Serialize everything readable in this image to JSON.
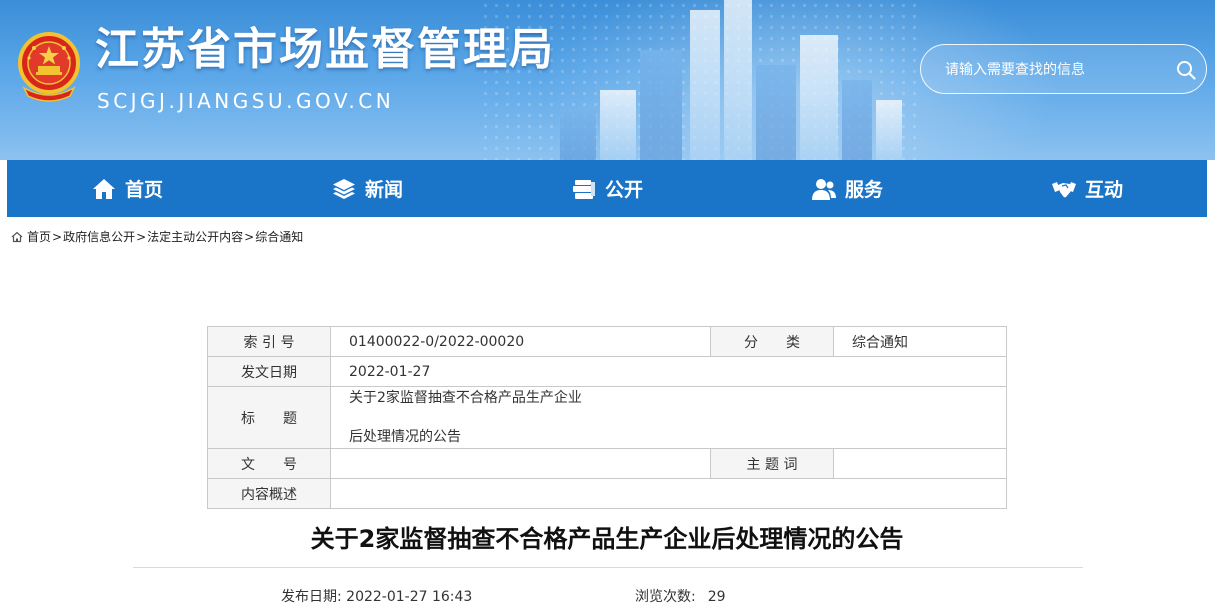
{
  "header": {
    "site_title": "江苏省市场监督管理局",
    "site_url": "SCJGJ.JIANGSU.GOV.CN",
    "emblem_icon": "national-emblem-icon",
    "search": {
      "placeholder": "请输入需要查找的信息",
      "icon": "search-icon"
    }
  },
  "nav": {
    "items": [
      {
        "label": "首页",
        "icon": "home-icon"
      },
      {
        "label": "新闻",
        "icon": "layers-icon"
      },
      {
        "label": "公开",
        "icon": "document-stack-icon"
      },
      {
        "label": "服务",
        "icon": "users-icon"
      },
      {
        "label": "互动",
        "icon": "handshake-icon"
      }
    ]
  },
  "breadcrumb": {
    "items": [
      "首页",
      "政府信息公开",
      "法定主动公开内容",
      "综合通知"
    ],
    "separator": ">"
  },
  "meta_table": {
    "index_label": "索 引 号",
    "index_value": "01400022-0/2022-00020",
    "category_label": "分　　类",
    "category_value": "综合通知",
    "date_label": "发文日期",
    "date_value": "2022-01-27",
    "title_label": "标　　题",
    "title_value_line1": "关于2家监督抽查不合格产品生产企业",
    "title_value_line2": "后处理情况的公告",
    "docno_label": "文　　号",
    "docno_value": "",
    "keyword_label": "主 题 词",
    "keyword_value": "",
    "summary_label": "内容概述",
    "summary_value": ""
  },
  "article": {
    "title": "关于2家监督抽查不合格产品生产企业后处理情况的公告",
    "publish_label": "发布日期:",
    "publish_value": "2022-01-27 16:43",
    "views_label": "浏览次数:",
    "views_value": "29"
  },
  "colors": {
    "nav_bg": "#1a74c8",
    "banner_top": "#3b8ed8",
    "table_border": "#c9c9c9",
    "label_bg": "#f5f5f5"
  }
}
